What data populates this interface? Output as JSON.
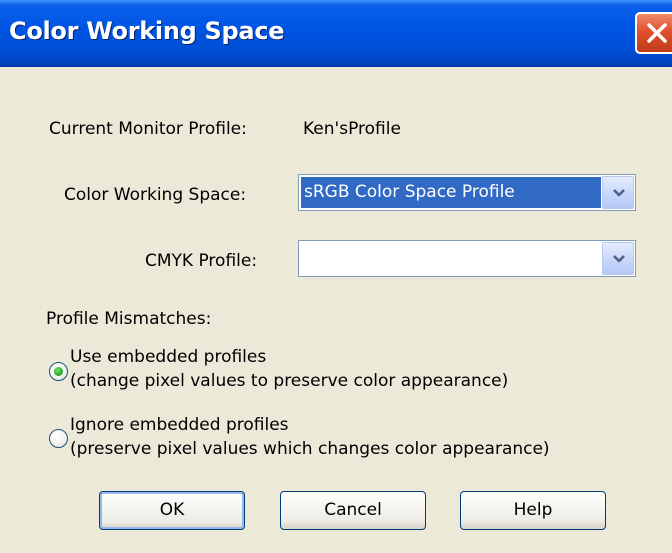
{
  "window": {
    "title": "Color Working Space"
  },
  "monitor_profile": {
    "label": "Current Monitor Profile:",
    "value": "Ken'sProfile"
  },
  "color_working_space": {
    "label": "Color Working Space:",
    "selected_value": "sRGB Color Space Profile"
  },
  "cmyk_profile": {
    "label": "CMYK Profile:",
    "selected_value": ""
  },
  "profile_mismatches": {
    "label": "Profile Mismatches:",
    "options": [
      {
        "line1": "Use embedded profiles",
        "line2": "(change pixel values to preserve color appearance)",
        "checked": true
      },
      {
        "line1": "Ignore embedded profiles",
        "line2": "(preserve pixel values which changes color appearance)",
        "checked": false
      }
    ]
  },
  "buttons": {
    "ok": "OK",
    "cancel": "Cancel",
    "help": "Help"
  },
  "colors": {
    "titlebar": "#0055e5",
    "dialog_background": "#ece9d8",
    "selection": "#316ac5",
    "close_button": "#e0522d"
  },
  "icons": {
    "close": "close-icon",
    "dropdown": "chevron-down-icon"
  }
}
